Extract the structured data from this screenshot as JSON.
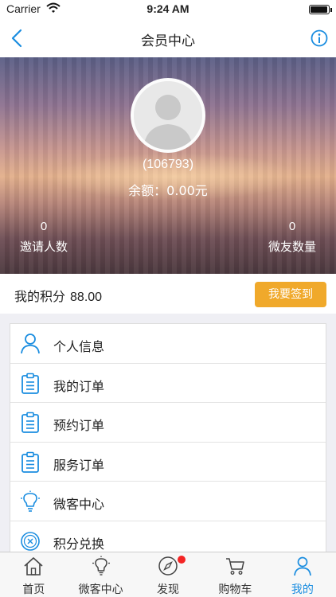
{
  "status": {
    "carrier": "Carrier",
    "time": "9:24 AM",
    "battery_level": 0.95
  },
  "nav": {
    "title": "会员中心"
  },
  "profile": {
    "user_id": "(106793)",
    "balance": "余额：0.00元",
    "invite_count": "0",
    "invite_label": "邀请人数",
    "fans_count": "0",
    "fans_label": "微友数量"
  },
  "points": {
    "label": "我的积分",
    "value": "88.00",
    "checkin_label": "我要签到"
  },
  "menu": [
    {
      "label": "个人信息",
      "icon": "person-icon"
    },
    {
      "label": "我的订单",
      "icon": "clipboard-icon"
    },
    {
      "label": "预约订单",
      "icon": "clipboard-icon"
    },
    {
      "label": "服务订单",
      "icon": "clipboard-icon"
    },
    {
      "label": "微客中心",
      "icon": "lightbulb-icon"
    },
    {
      "label": "积分兑换",
      "icon": "points-icon"
    }
  ],
  "tabs": [
    {
      "label": "首页",
      "icon": "home-icon"
    },
    {
      "label": "微客中心",
      "icon": "lightbulb-icon"
    },
    {
      "label": "发现",
      "icon": "compass-icon"
    },
    {
      "label": "购物车",
      "icon": "cart-icon"
    },
    {
      "label": "我的",
      "icon": "person-icon"
    }
  ],
  "colors": {
    "accent": "#1a8de0",
    "checkin": "#f0a92b",
    "badge": "#f42424"
  }
}
